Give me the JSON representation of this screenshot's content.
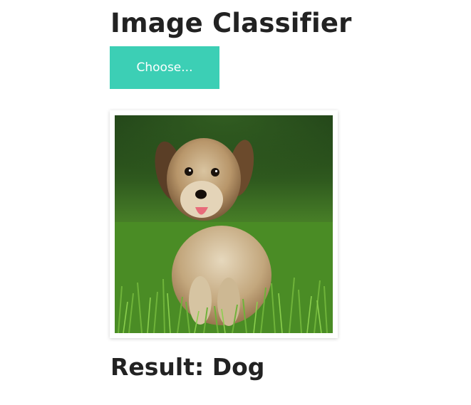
{
  "header": {
    "title": "Image Classifier"
  },
  "upload": {
    "button_label": "Choose..."
  },
  "preview": {
    "image_subject": "dog puppy sitting in grass"
  },
  "result": {
    "prefix": "Result:",
    "label": "Dog"
  },
  "colors": {
    "accent": "#3ccfb5",
    "text": "#222222",
    "background": "#ffffff"
  }
}
